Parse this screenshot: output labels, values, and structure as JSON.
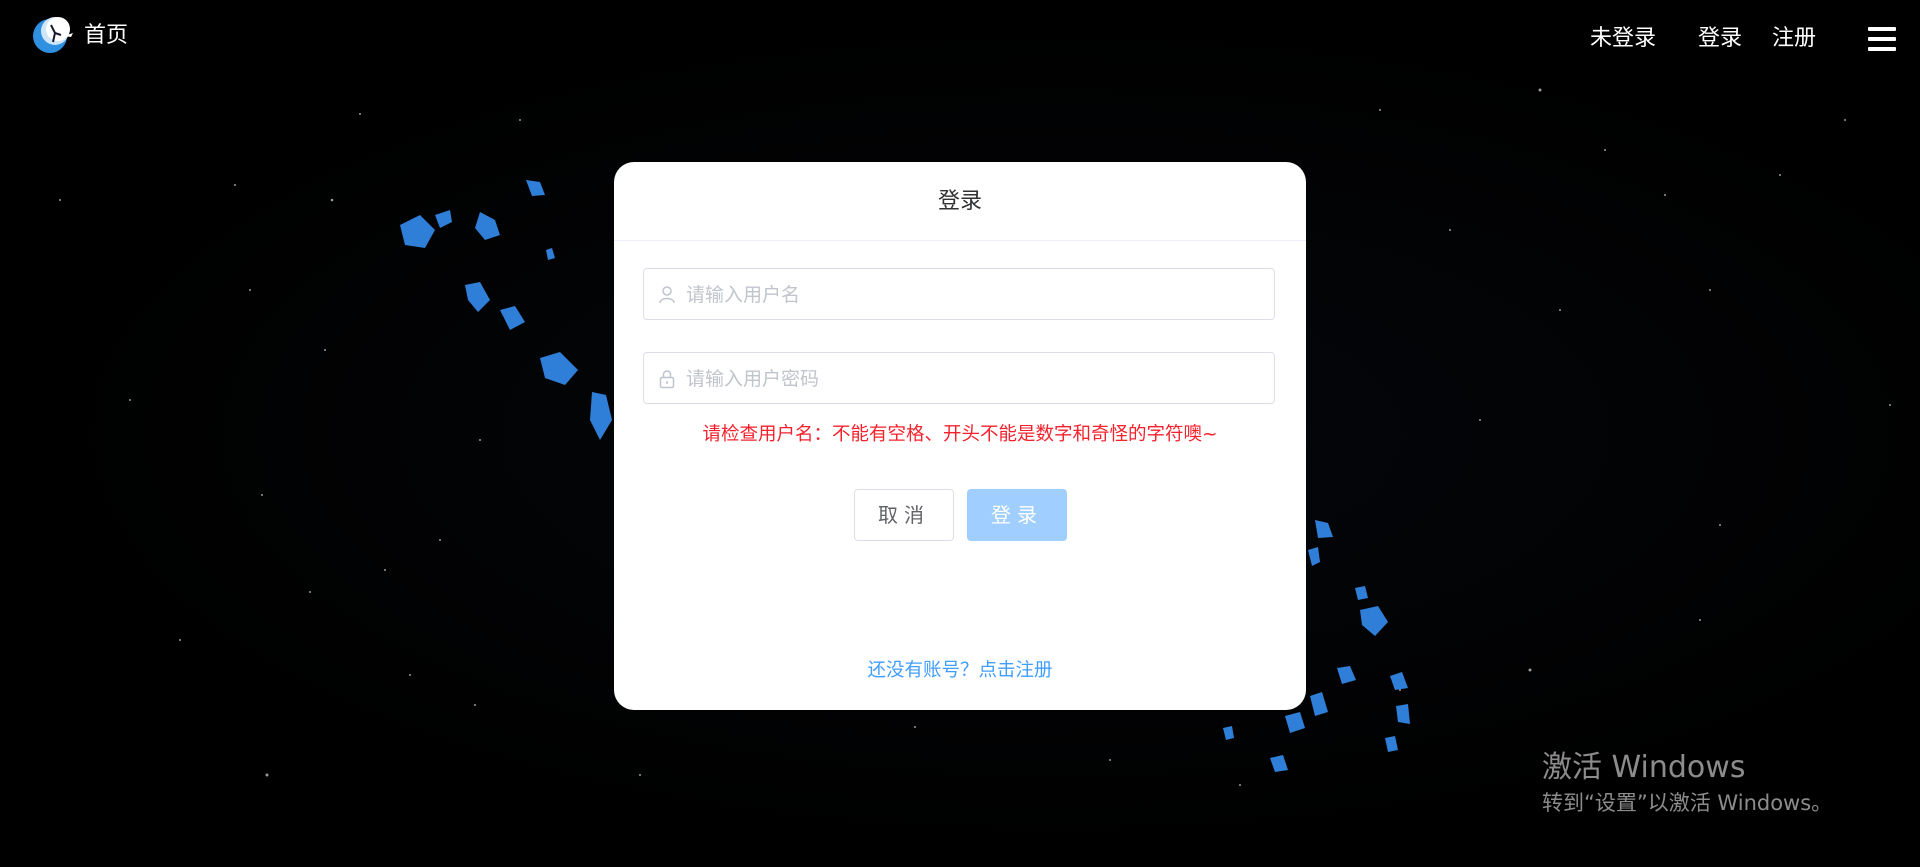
{
  "nav": {
    "home_label": "首页",
    "status": "未登录",
    "login_label": "登录",
    "register_label": "注册",
    "menu_icon": "hamburger-menu-icon"
  },
  "login_card": {
    "title": "登录",
    "username": {
      "placeholder": "请输入用户名",
      "value": "",
      "icon": "user-icon"
    },
    "password": {
      "placeholder": "请输入用户密码",
      "value": "",
      "icon": "lock-icon"
    },
    "error_message": "请检查用户名：不能有空格、开头不能是数字和奇怪的字符噢~",
    "cancel_button": "取消",
    "login_button": "登录",
    "register_link": "还没有账号？点击注册"
  },
  "watermark": {
    "title": "激活 Windows",
    "subtitle": "转到“设置”以激活 Windows。"
  },
  "colors": {
    "background": "#000000",
    "card": "#ffffff",
    "error": "#f5222d",
    "link": "#409eff",
    "login_button": "#a0cfff",
    "crystals": "#2f7fd8"
  }
}
